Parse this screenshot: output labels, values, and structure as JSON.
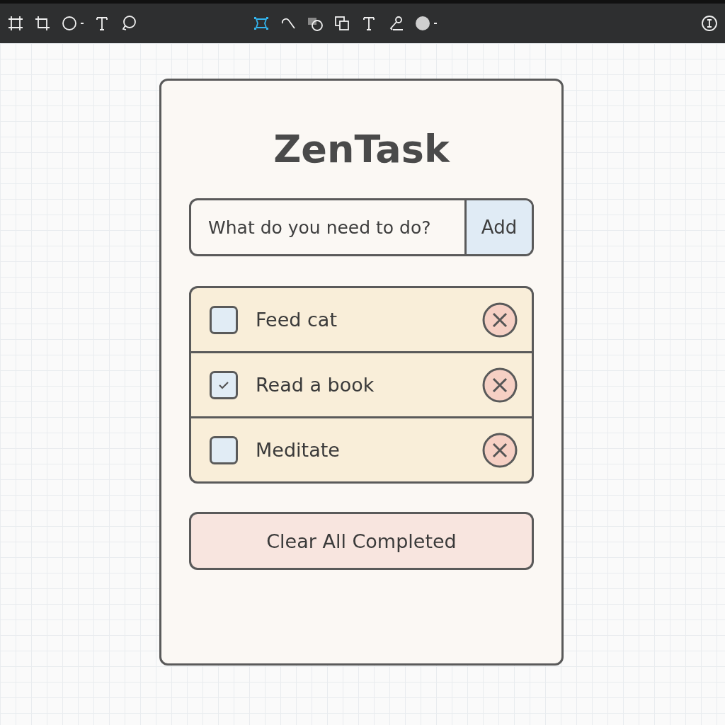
{
  "toolbar": {
    "left_tools": [
      {
        "kind": "frame",
        "selected": false,
        "dropdown": false
      },
      {
        "kind": "crop",
        "selected": false,
        "dropdown": false
      },
      {
        "kind": "ellipse",
        "selected": false,
        "dropdown": true
      },
      {
        "kind": "text",
        "selected": false,
        "dropdown": false
      },
      {
        "kind": "lasso",
        "selected": false,
        "dropdown": false
      }
    ],
    "center_tools": [
      {
        "kind": "select",
        "selected": true,
        "dropdown": false
      },
      {
        "kind": "curve",
        "selected": false,
        "dropdown": false
      },
      {
        "kind": "shapes",
        "selected": false,
        "dropdown": false
      },
      {
        "kind": "duplicate",
        "selected": false,
        "dropdown": false
      },
      {
        "kind": "text",
        "selected": false,
        "dropdown": false
      },
      {
        "kind": "pen",
        "selected": false,
        "dropdown": false
      },
      {
        "kind": "fill",
        "selected": false,
        "dropdown": true
      }
    ],
    "right_tools": [
      {
        "kind": "info",
        "selected": false,
        "dropdown": false
      }
    ]
  },
  "app": {
    "title": "ZenTask",
    "new_task": {
      "placeholder": "What do you need to do?",
      "button": "Add"
    },
    "tasks": [
      {
        "label": "Feed cat",
        "checked": false
      },
      {
        "label": "Read a book",
        "checked": true
      },
      {
        "label": "Meditate",
        "checked": false
      }
    ],
    "clear_button": "Clear All Completed"
  }
}
